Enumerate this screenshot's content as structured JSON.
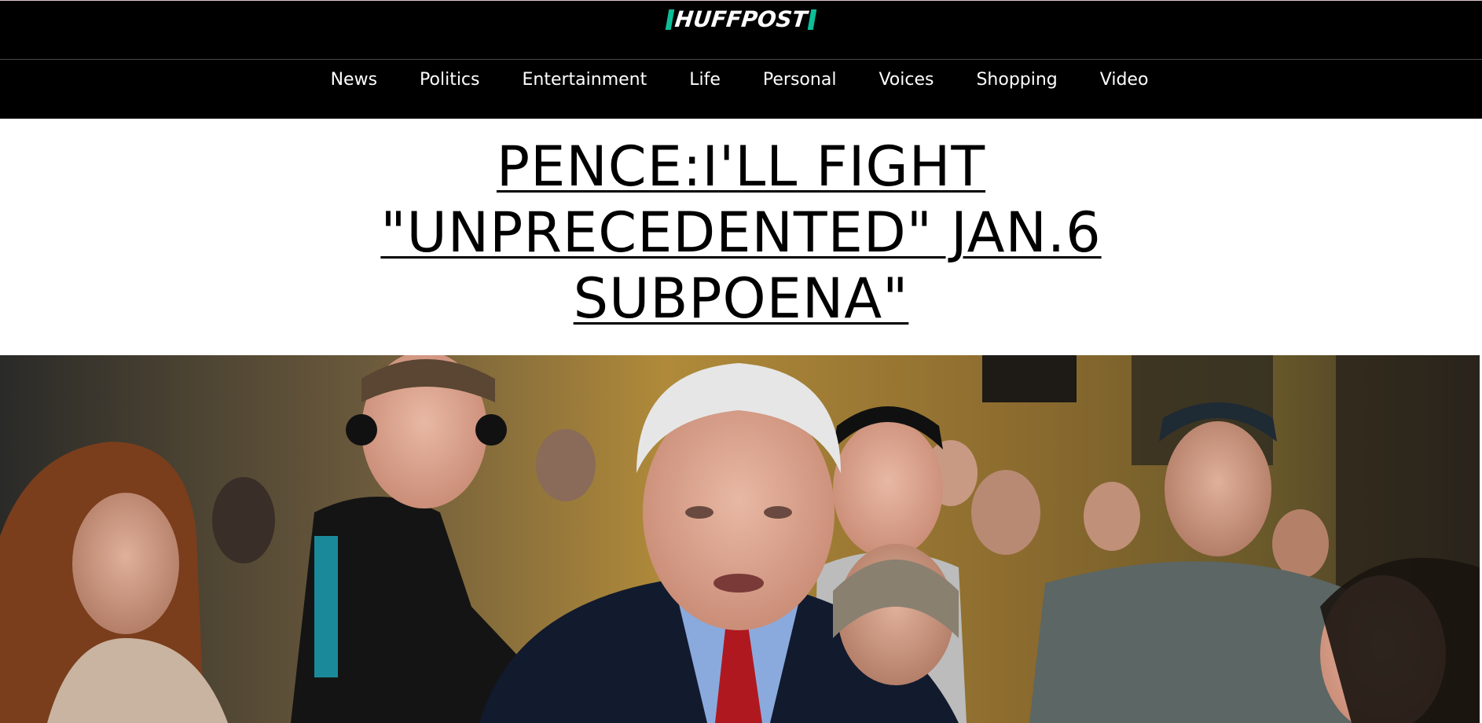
{
  "header": {
    "logo_text": "HUFFPOST",
    "brand_color": "#0dbe98",
    "background_color": "#000000"
  },
  "nav": {
    "items": [
      {
        "label": "News"
      },
      {
        "label": "Politics"
      },
      {
        "label": "Entertainment"
      },
      {
        "label": "Life"
      },
      {
        "label": "Personal"
      },
      {
        "label": "Voices"
      },
      {
        "label": "Shopping"
      },
      {
        "label": "Video"
      }
    ]
  },
  "article": {
    "headline": "PENCE:I'LL FIGHT \"UNPRECEDENTED\" JAN.6 SUBPOENA\""
  },
  "hero_image": {
    "icon": "photo-of-mike-pence-among-crowd"
  }
}
